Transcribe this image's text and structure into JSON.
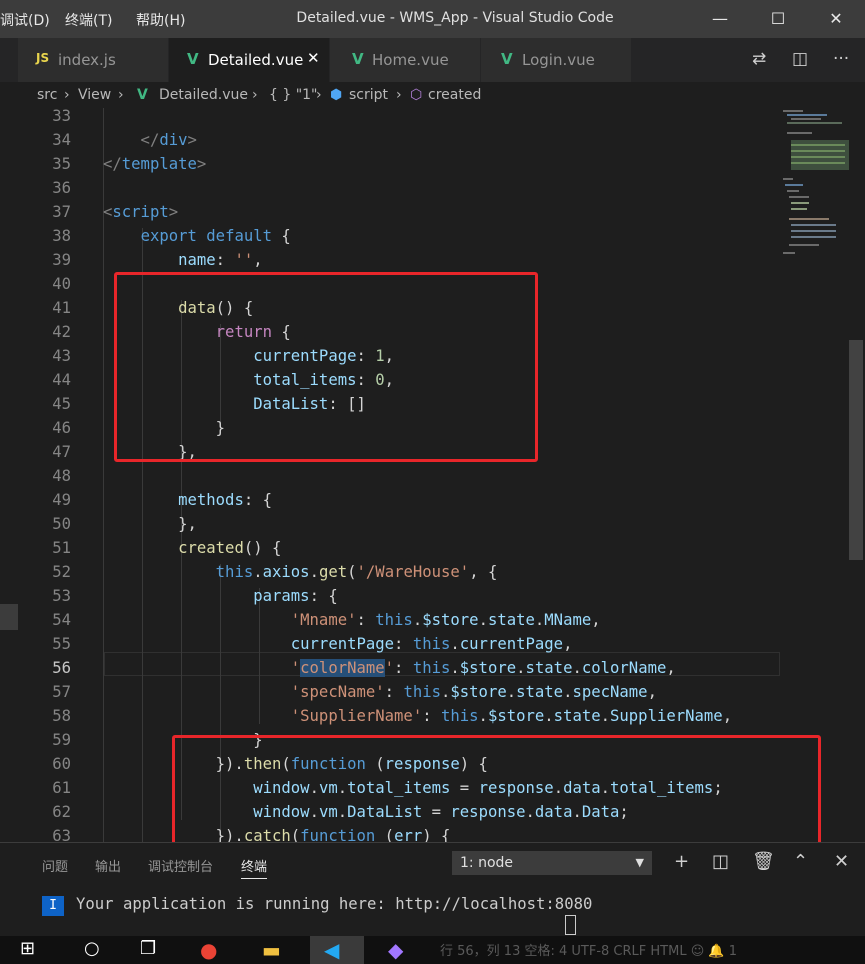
{
  "window": {
    "title": "Detailed.vue - WMS_App - Visual Studio Code",
    "menu": [
      "调试(D)",
      "终端(T)",
      "帮助(H)"
    ]
  },
  "tabs": [
    {
      "icon": "JS",
      "label": "index.js",
      "active": false
    },
    {
      "icon": "V",
      "label": "Detailed.vue",
      "active": true,
      "close": "✕"
    },
    {
      "icon": "V",
      "label": "Home.vue",
      "active": false
    },
    {
      "icon": "V",
      "label": "Login.vue",
      "active": false
    }
  ],
  "breadcrumb": {
    "items": [
      "src",
      "View",
      "Detailed.vue",
      "{ } \"1\"",
      "script",
      "created"
    ],
    "separator": "›"
  },
  "editor": {
    "current_line": 56,
    "lines": [
      {
        "n": "33",
        "code": [
          [
            "w",
            ""
          ]
        ]
      },
      {
        "n": "34",
        "code": [
          [
            "tp",
            "    </"
          ],
          [
            "t",
            "div"
          ],
          [
            "tp",
            ">"
          ]
        ]
      },
      {
        "n": "35",
        "code": [
          [
            "tp",
            "</"
          ],
          [
            "t",
            "template"
          ],
          [
            "tp",
            ">"
          ]
        ]
      },
      {
        "n": "36",
        "code": [
          [
            "w",
            ""
          ]
        ]
      },
      {
        "n": "37",
        "code": [
          [
            "tp",
            "<"
          ],
          [
            "t",
            "script"
          ],
          [
            "tp",
            ">"
          ]
        ]
      },
      {
        "n": "38",
        "code": [
          [
            "w",
            "    "
          ],
          [
            "k",
            "export"
          ],
          [
            "w",
            " "
          ],
          [
            "k",
            "default"
          ],
          [
            "w",
            " {"
          ]
        ]
      },
      {
        "n": "39",
        "code": [
          [
            "w",
            "        "
          ],
          [
            "p",
            "name"
          ],
          [
            "w",
            ": "
          ],
          [
            "s",
            "''"
          ],
          [
            "w",
            ","
          ]
        ]
      },
      {
        "n": "40",
        "code": [
          [
            "w",
            ""
          ]
        ]
      },
      {
        "n": "41",
        "code": [
          [
            "w",
            "        "
          ],
          [
            "f",
            "data"
          ],
          [
            "w",
            "() {"
          ]
        ]
      },
      {
        "n": "42",
        "code": [
          [
            "w",
            "            "
          ],
          [
            "kc",
            "return"
          ],
          [
            "w",
            " {"
          ]
        ]
      },
      {
        "n": "43",
        "code": [
          [
            "w",
            "                "
          ],
          [
            "p",
            "currentPage"
          ],
          [
            "w",
            ": "
          ],
          [
            "n",
            "1"
          ],
          [
            "w",
            ","
          ]
        ]
      },
      {
        "n": "44",
        "code": [
          [
            "w",
            "                "
          ],
          [
            "p",
            "total_items"
          ],
          [
            "w",
            ": "
          ],
          [
            "n",
            "0"
          ],
          [
            "w",
            ","
          ]
        ]
      },
      {
        "n": "45",
        "code": [
          [
            "w",
            "                "
          ],
          [
            "p",
            "DataList"
          ],
          [
            "w",
            ": []"
          ]
        ]
      },
      {
        "n": "46",
        "code": [
          [
            "w",
            "            }"
          ]
        ]
      },
      {
        "n": "47",
        "code": [
          [
            "w",
            "        },"
          ]
        ]
      },
      {
        "n": "48",
        "code": [
          [
            "w",
            ""
          ]
        ]
      },
      {
        "n": "49",
        "code": [
          [
            "w",
            "        "
          ],
          [
            "p",
            "methods"
          ],
          [
            "w",
            ": {"
          ]
        ]
      },
      {
        "n": "50",
        "code": [
          [
            "w",
            "        },"
          ]
        ]
      },
      {
        "n": "51",
        "code": [
          [
            "w",
            "        "
          ],
          [
            "f",
            "created"
          ],
          [
            "w",
            "() {"
          ]
        ]
      },
      {
        "n": "52",
        "code": [
          [
            "w",
            "            "
          ],
          [
            "k",
            "this"
          ],
          [
            "w",
            "."
          ],
          [
            "p",
            "axios"
          ],
          [
            "w",
            "."
          ],
          [
            "f",
            "get"
          ],
          [
            "w",
            "("
          ],
          [
            "s",
            "'/WareHouse'"
          ],
          [
            "w",
            ", {"
          ]
        ]
      },
      {
        "n": "53",
        "code": [
          [
            "w",
            "                "
          ],
          [
            "p",
            "params"
          ],
          [
            "w",
            ": {"
          ]
        ]
      },
      {
        "n": "54",
        "code": [
          [
            "w",
            "                    "
          ],
          [
            "s",
            "'Mname'"
          ],
          [
            "w",
            ": "
          ],
          [
            "k",
            "this"
          ],
          [
            "w",
            "."
          ],
          [
            "p",
            "$store"
          ],
          [
            "w",
            "."
          ],
          [
            "p",
            "state"
          ],
          [
            "w",
            "."
          ],
          [
            "p",
            "MName"
          ],
          [
            "w",
            ","
          ]
        ]
      },
      {
        "n": "55",
        "code": [
          [
            "w",
            "                    "
          ],
          [
            "p",
            "currentPage"
          ],
          [
            "w",
            ": "
          ],
          [
            "k",
            "this"
          ],
          [
            "w",
            "."
          ],
          [
            "p",
            "currentPage"
          ],
          [
            "w",
            ","
          ]
        ]
      },
      {
        "n": "56",
        "code": [
          [
            "w",
            "                    "
          ],
          [
            "s",
            "'"
          ],
          [
            "s hl",
            "colorName"
          ],
          [
            "s",
            "'"
          ],
          [
            "w",
            ": "
          ],
          [
            "k",
            "this"
          ],
          [
            "w",
            "."
          ],
          [
            "p",
            "$store"
          ],
          [
            "w",
            "."
          ],
          [
            "p",
            "state"
          ],
          [
            "w",
            "."
          ],
          [
            "p",
            "colorName"
          ],
          [
            "w",
            ","
          ]
        ]
      },
      {
        "n": "57",
        "code": [
          [
            "w",
            "                    "
          ],
          [
            "s",
            "'specName'"
          ],
          [
            "w",
            ": "
          ],
          [
            "k",
            "this"
          ],
          [
            "w",
            "."
          ],
          [
            "p",
            "$store"
          ],
          [
            "w",
            "."
          ],
          [
            "p",
            "state"
          ],
          [
            "w",
            "."
          ],
          [
            "p",
            "specName"
          ],
          [
            "w",
            ","
          ]
        ]
      },
      {
        "n": "58",
        "code": [
          [
            "w",
            "                    "
          ],
          [
            "s",
            "'SupplierName'"
          ],
          [
            "w",
            ": "
          ],
          [
            "k",
            "this"
          ],
          [
            "w",
            "."
          ],
          [
            "p",
            "$store"
          ],
          [
            "w",
            "."
          ],
          [
            "p",
            "state"
          ],
          [
            "w",
            "."
          ],
          [
            "p",
            "SupplierName"
          ],
          [
            "w",
            ","
          ]
        ]
      },
      {
        "n": "59",
        "code": [
          [
            "w",
            "                }"
          ]
        ]
      },
      {
        "n": "60",
        "code": [
          [
            "w",
            "            })."
          ],
          [
            "f",
            "then"
          ],
          [
            "w",
            "("
          ],
          [
            "k",
            "function"
          ],
          [
            "w",
            " ("
          ],
          [
            "p",
            "response"
          ],
          [
            "w",
            ") {"
          ]
        ]
      },
      {
        "n": "61",
        "code": [
          [
            "w",
            "                "
          ],
          [
            "p",
            "window"
          ],
          [
            "w",
            "."
          ],
          [
            "p",
            "vm"
          ],
          [
            "w",
            "."
          ],
          [
            "p",
            "total_items"
          ],
          [
            "w",
            " = "
          ],
          [
            "p",
            "response"
          ],
          [
            "w",
            "."
          ],
          [
            "p",
            "data"
          ],
          [
            "w",
            "."
          ],
          [
            "p",
            "total_items"
          ],
          [
            "w",
            ";"
          ]
        ]
      },
      {
        "n": "62",
        "code": [
          [
            "w",
            "                "
          ],
          [
            "p",
            "window"
          ],
          [
            "w",
            "."
          ],
          [
            "p",
            "vm"
          ],
          [
            "w",
            "."
          ],
          [
            "p",
            "DataList"
          ],
          [
            "w",
            " = "
          ],
          [
            "p",
            "response"
          ],
          [
            "w",
            "."
          ],
          [
            "p",
            "data"
          ],
          [
            "w",
            "."
          ],
          [
            "p",
            "Data"
          ],
          [
            "w",
            ";"
          ]
        ]
      },
      {
        "n": "63",
        "code": [
          [
            "w",
            "            })."
          ],
          [
            "f",
            "catch"
          ],
          [
            "w",
            "("
          ],
          [
            "k",
            "function"
          ],
          [
            "w",
            " ("
          ],
          [
            "p",
            "err"
          ],
          [
            "w",
            ") {"
          ]
        ]
      }
    ]
  },
  "panel": {
    "tabs": [
      "问题",
      "输出",
      "调试控制台",
      "终端"
    ],
    "active_tab": "终端",
    "terminal_select": "1: node",
    "terminal_badge": "I",
    "terminal_line": "Your application is running here: http://localhost:8080"
  },
  "statusbar": {
    "text": "行 56，列 13   空格: 4   UTF-8   CRLF   HTML   ☺   🔔 1"
  },
  "colors": {
    "accent_red": "#e8262a",
    "vue_green": "#41b883",
    "vscode_blue": "#0e63c7"
  }
}
